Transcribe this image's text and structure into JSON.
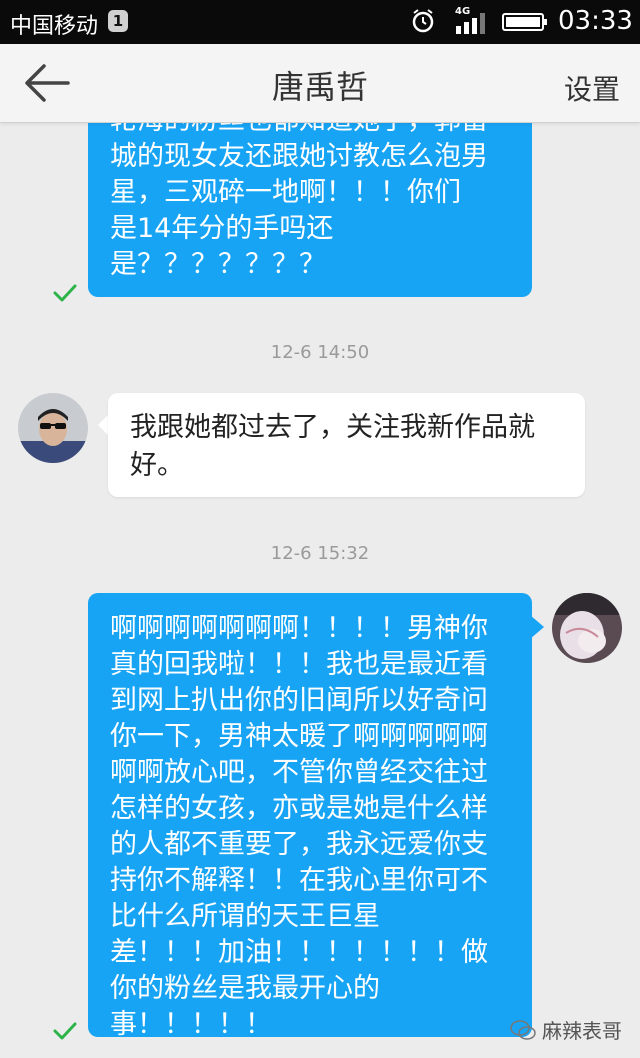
{
  "status_bar": {
    "carrier": "中国移动",
    "notification_count": "1",
    "network": "4G",
    "time": "03:33"
  },
  "header": {
    "title": "唐禹哲",
    "settings_label": "设置"
  },
  "messages": [
    {
      "direction": "outgoing",
      "text": "轮海的粉丝也都知道她了，郭富\n城的现女友还跟她讨教怎么泡男\n星，三观碎一地啊！！！你们\n是14年分的手吗还\n是？？？？？？？",
      "status": "sent"
    },
    {
      "timestamp": "12-6 14:50"
    },
    {
      "direction": "incoming",
      "text": "我跟她都过去了，关注我新作品就\n好。"
    },
    {
      "timestamp": "12-6 15:32"
    },
    {
      "direction": "outgoing",
      "text": "啊啊啊啊啊啊啊！！！！男神你\n真的回我啦！！！我也是最近看\n到网上扒出你的旧闻所以好奇问\n你一下，男神太暖了啊啊啊啊啊\n啊啊放心吧，不管你曾经交往过\n怎样的女孩，亦或是她是什么样\n的人都不重要了，我永远爱你支\n持你不解释！！在我心里你可不\n比什么所谓的天王巨星\n差！！！加油！！！！！！！做\n你的粉丝是我最开心的\n事！！！！！",
      "status": "sent"
    }
  ],
  "watermark": "麻辣表哥",
  "colors": {
    "outgoing_bubble": "#18a4f5",
    "incoming_bubble": "#ffffff",
    "background": "#ececec",
    "check": "#2db34a"
  }
}
